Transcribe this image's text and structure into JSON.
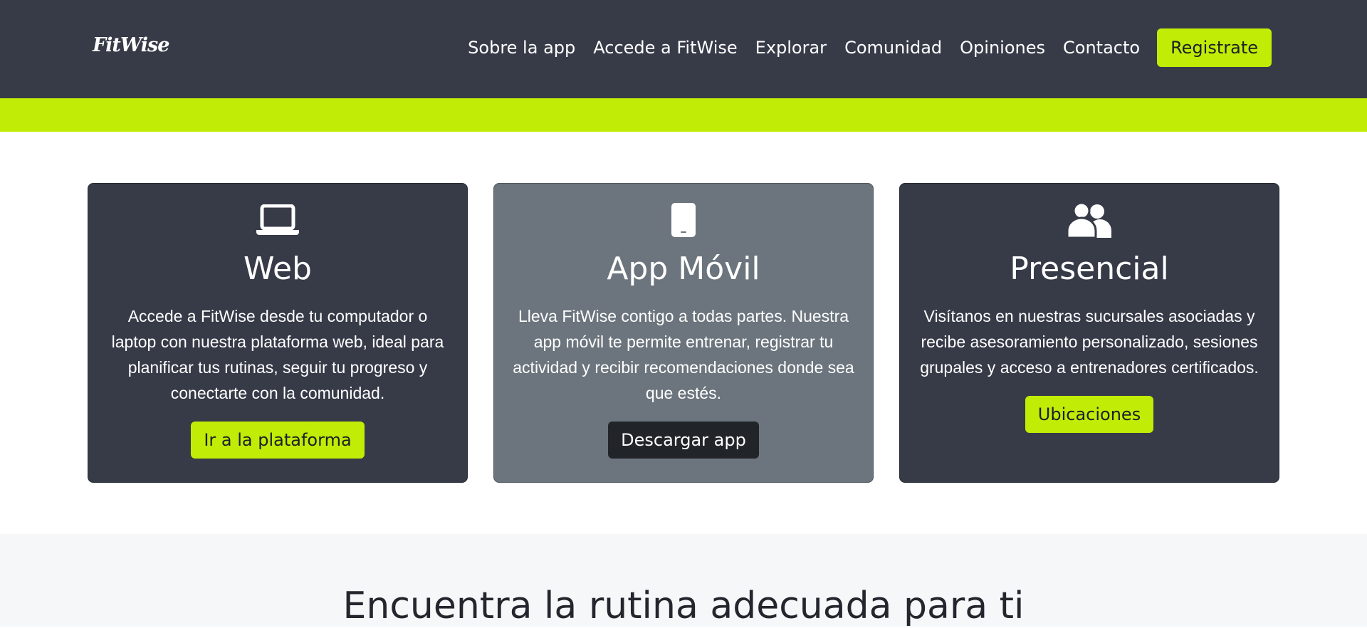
{
  "header": {
    "logo": "FitWise",
    "nav": [
      {
        "label": "Sobre la app"
      },
      {
        "label": "Accede a FitWise"
      },
      {
        "label": "Explorar"
      },
      {
        "label": "Comunidad"
      },
      {
        "label": "Opiniones"
      },
      {
        "label": "Contacto"
      }
    ],
    "register_label": "Registrate"
  },
  "colors": {
    "navbar": "#373b48",
    "accent": "#c1ec06",
    "card_dark": "#373b48",
    "card_grey": "#6c757d",
    "button_dark": "#212529"
  },
  "cards": [
    {
      "icon": "laptop-icon",
      "title": "Web",
      "text": "Accede a FitWise desde tu computador o laptop con nuestra plataforma web, ideal para planificar tus rutinas, seguir tu progreso y conectarte con la comunidad.",
      "button": "Ir a la plataforma"
    },
    {
      "icon": "mobile-phone-icon",
      "title": "App Móvil",
      "text": "Lleva FitWise contigo a todas partes. Nuestra app móvil te permite entrenar, registrar tu actividad y recibir recomendaciones donde sea que estés.",
      "button": "Descargar app"
    },
    {
      "icon": "users-icon",
      "title": "Presencial",
      "text": "Visítanos en nuestras sucursales asociadas y recibe asesoramiento personalizado, sesiones grupales y acceso a entrenadores certificados.",
      "button": "Ubicaciones"
    }
  ],
  "routines": {
    "heading": "Encuentra la rutina adecuada para ti"
  }
}
